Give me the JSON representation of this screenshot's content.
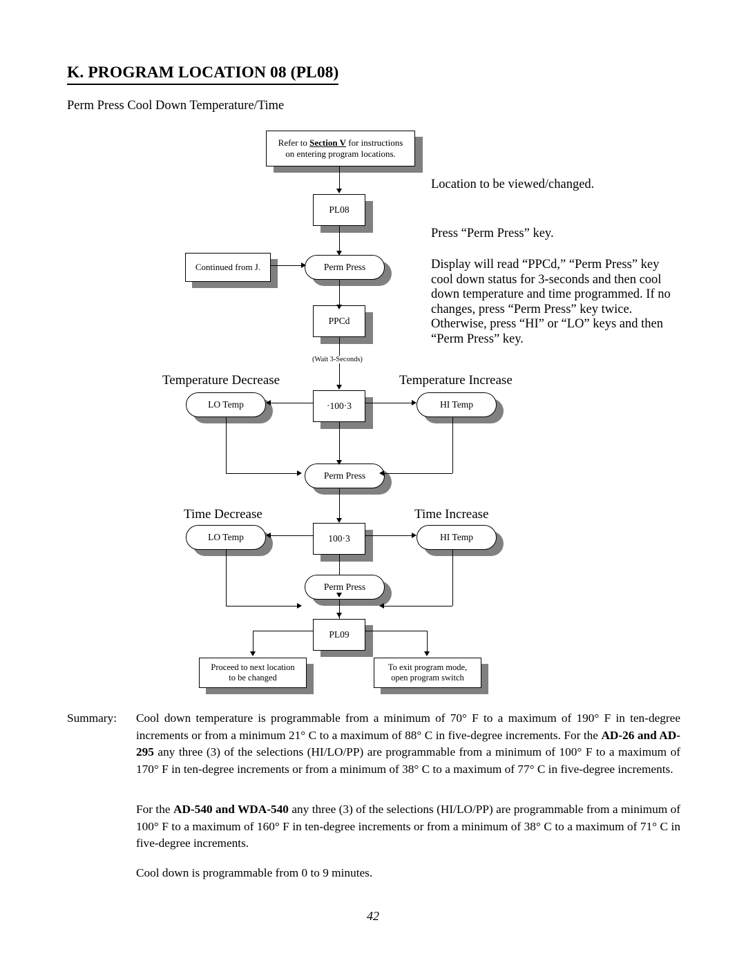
{
  "heading": "K.  PROGRAM LOCATION 08 (PL08)",
  "subtitle": "Perm Press Cool Down Temperature/Time",
  "flowchart": {
    "refer_box": {
      "line1_pre": "Refer to ",
      "line1_bold": "Section V",
      "line1_post": " for instructions",
      "line2": "on entering program locations."
    },
    "pl08": "PL08",
    "continued_from": "Continued from J.",
    "perm_press_1": "Perm Press",
    "ppcd": "PPCd",
    "wait_note": "(Wait 3-Seconds)",
    "temp_decrease_caption": "Temperature  Decrease",
    "temp_increase_caption": "Temperature Increase",
    "lo_temp_1": "LO Temp",
    "temp_value": "·100·3",
    "hi_temp_1": "HI Temp",
    "perm_press_2": "Perm Press",
    "time_decrease_caption": "Time  Decrease",
    "time_increase_caption": "Time  Increase",
    "lo_temp_2": "LO Temp",
    "time_value": "100·3",
    "hi_temp_2": "HI Temp",
    "perm_press_3": "Perm Press",
    "pl09": "PL09",
    "proceed_box_line1": "Proceed to next location",
    "proceed_box_line2": "to be changed",
    "exit_box_line1": "To exit program mode,",
    "exit_box_line2": "open program switch"
  },
  "side_notes": {
    "note1": "Location to be viewed/changed.",
    "note2": "Press “Perm Press” key.",
    "note3": "Display will read “PPCd,” “Perm Press” key cool down status for 3-seconds and then cool down temperature and time programmed.  If no changes, press “Perm Press” key twice.  Otherwise, press “HI” or “LO” keys and then “Perm Press” key."
  },
  "summary": {
    "label": "Summary:",
    "para1_a": "Cool down temperature is programmable from a minimum of 70° F to a maximum of 190° F in ten-degree increments or from a minimum 21° C to a maximum of 88° C in five-degree increments. For the ",
    "para1_bold": "AD-26 and AD-295",
    "para1_b": " any three (3) of the selections (HI/LO/PP) are programmable from a minimum of 100° F to a maximum of 170° F in ten-degree increments or from a minimum of 38° C to a maximum of 77° C in five-degree increments.",
    "para2_a": "For the ",
    "para2_bold": "AD-540 and WDA-540",
    "para2_b": " any three (3) of the selections (HI/LO/PP) are programmable from a minimum of 100° F to a maximum of 160° F in ten-degree increments or from a minimum of 38° C to a maximum of 71° C in five-degree increments.",
    "para3": "Cool down is programmable from 0 to 9 minutes."
  },
  "page_number": "42",
  "colors": {
    "shadow": "#808080",
    "line": "#000000",
    "background": "#ffffff"
  }
}
